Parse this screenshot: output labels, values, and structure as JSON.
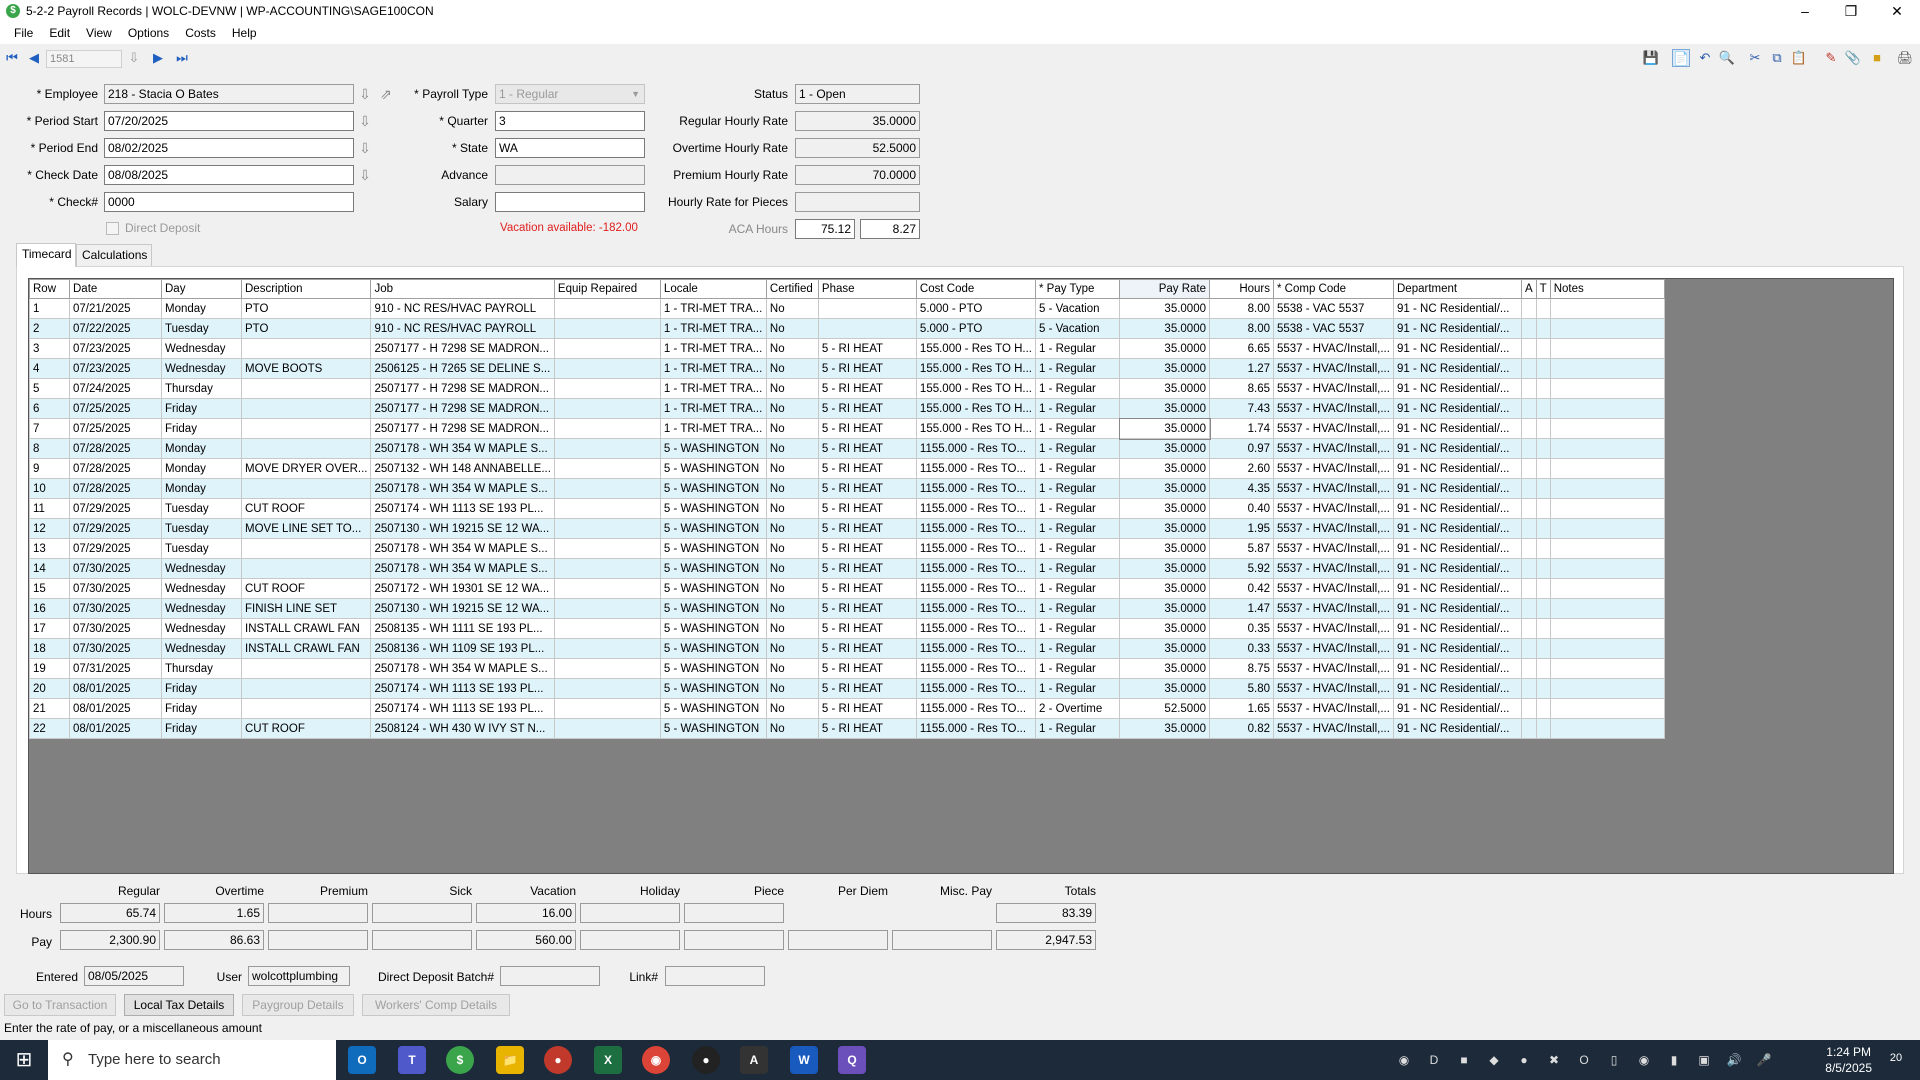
{
  "window": {
    "title": "5-2-2 Payroll Records  |  WOLC-DEVNW  |  WP-ACCOUNTING\\SAGE100CON"
  },
  "menu": [
    "File",
    "Edit",
    "View",
    "Options",
    "Costs",
    "Help"
  ],
  "nav": {
    "record": "1581"
  },
  "form": {
    "employee_label": "Employee",
    "employee": "218 - Stacia O Bates",
    "period_start_label": "Period Start",
    "period_start": "07/20/2025",
    "period_end_label": "Period End",
    "period_end": "08/02/2025",
    "check_date_label": "Check Date",
    "check_date": "08/08/2025",
    "check_no_label": "Check#",
    "check_no": "0000",
    "direct_deposit_label": "Direct Deposit",
    "payroll_type_label": "Payroll Type",
    "payroll_type": "1 - Regular",
    "quarter_label": "Quarter",
    "quarter": "3",
    "state_label": "State",
    "state": "WA",
    "advance_label": "Advance",
    "advance": "",
    "salary_label": "Salary",
    "salary": "",
    "vacation_available": "Vacation available:  -182.00",
    "status_label": "Status",
    "status": "1 - Open",
    "regular_rate_label": "Regular Hourly Rate",
    "regular_rate": "35.0000",
    "overtime_rate_label": "Overtime Hourly Rate",
    "overtime_rate": "52.5000",
    "premium_rate_label": "Premium Hourly Rate",
    "premium_rate": "70.0000",
    "pieces_rate_label": "Hourly Rate for Pieces",
    "pieces_rate": "",
    "aca_hours_label": "ACA Hours",
    "aca_hours_1": "75.12",
    "aca_hours_2": "8.27"
  },
  "tabs": [
    "Timecard",
    "Calculations"
  ],
  "grid": {
    "columns": [
      "Row",
      "Date",
      "Day",
      "Description",
      "Job",
      "Equip Repaired",
      "Locale",
      "Certified",
      "Phase",
      "Cost Code",
      "* Pay Type",
      "Pay Rate",
      "Hours",
      "* Comp Code",
      "Department",
      "A",
      "T",
      "Notes"
    ],
    "rows": [
      [
        "1",
        "07/21/2025",
        "Monday",
        "PTO",
        "910 - NC RES/HVAC PAYROLL",
        "",
        "1 - TRI-MET TRA...",
        "No",
        "",
        "5.000 - PTO",
        "5 - Vacation",
        "35.0000",
        "8.00",
        "5538 - VAC 5537",
        "91 - NC Residential/...",
        "",
        "",
        ""
      ],
      [
        "2",
        "07/22/2025",
        "Tuesday",
        "PTO",
        "910 - NC RES/HVAC PAYROLL",
        "",
        "1 - TRI-MET TRA...",
        "No",
        "",
        "5.000 - PTO",
        "5 - Vacation",
        "35.0000",
        "8.00",
        "5538 - VAC 5537",
        "91 - NC Residential/...",
        "",
        "",
        ""
      ],
      [
        "3",
        "07/23/2025",
        "Wednesday",
        "",
        "2507177 - H 7298 SE MADRON...",
        "",
        "1 - TRI-MET TRA...",
        "No",
        "5 - RI HEAT",
        "155.000 - Res TO H...",
        "1 - Regular",
        "35.0000",
        "6.65",
        "5537 - HVAC/Install,...",
        "91 - NC Residential/...",
        "",
        "",
        ""
      ],
      [
        "4",
        "07/23/2025",
        "Wednesday",
        "MOVE BOOTS",
        "2506125 - H 7265 SE DELINE S...",
        "",
        "1 - TRI-MET TRA...",
        "No",
        "5 - RI HEAT",
        "155.000 - Res TO H...",
        "1 - Regular",
        "35.0000",
        "1.27",
        "5537 - HVAC/Install,...",
        "91 - NC Residential/...",
        "",
        "",
        ""
      ],
      [
        "5",
        "07/24/2025",
        "Thursday",
        "",
        "2507177 - H 7298 SE MADRON...",
        "",
        "1 - TRI-MET TRA...",
        "No",
        "5 - RI HEAT",
        "155.000 - Res TO H...",
        "1 - Regular",
        "35.0000",
        "8.65",
        "5537 - HVAC/Install,...",
        "91 - NC Residential/...",
        "",
        "",
        ""
      ],
      [
        "6",
        "07/25/2025",
        "Friday",
        "",
        "2507177 - H 7298 SE MADRON...",
        "",
        "1 - TRI-MET TRA...",
        "No",
        "5 - RI HEAT",
        "155.000 - Res TO H...",
        "1 - Regular",
        "35.0000",
        "7.43",
        "5537 - HVAC/Install,...",
        "91 - NC Residential/...",
        "",
        "",
        ""
      ],
      [
        "7",
        "07/25/2025",
        "Friday",
        "",
        "2507177 - H 7298 SE MADRON...",
        "",
        "1 - TRI-MET TRA...",
        "No",
        "5 - RI HEAT",
        "155.000 - Res TO H...",
        "1 - Regular",
        "35.0000",
        "1.74",
        "5537 - HVAC/Install,...",
        "91 - NC Residential/...",
        "",
        "",
        ""
      ],
      [
        "8",
        "07/28/2025",
        "Monday",
        "",
        "2507178 - WH 354 W MAPLE S...",
        "",
        "5 - WASHINGTON",
        "No",
        "5 - RI HEAT",
        "1155.000 - Res TO...",
        "1 - Regular",
        "35.0000",
        "0.97",
        "5537 - HVAC/Install,...",
        "91 - NC Residential/...",
        "",
        "",
        ""
      ],
      [
        "9",
        "07/28/2025",
        "Monday",
        "MOVE DRYER OVER...",
        "2507132 - WH 148 ANNABELLE...",
        "",
        "5 - WASHINGTON",
        "No",
        "5 - RI HEAT",
        "1155.000 - Res TO...",
        "1 - Regular",
        "35.0000",
        "2.60",
        "5537 - HVAC/Install,...",
        "91 - NC Residential/...",
        "",
        "",
        ""
      ],
      [
        "10",
        "07/28/2025",
        "Monday",
        "",
        "2507178 - WH 354 W MAPLE S...",
        "",
        "5 - WASHINGTON",
        "No",
        "5 - RI HEAT",
        "1155.000 - Res TO...",
        "1 - Regular",
        "35.0000",
        "4.35",
        "5537 - HVAC/Install,...",
        "91 - NC Residential/...",
        "",
        "",
        ""
      ],
      [
        "11",
        "07/29/2025",
        "Tuesday",
        "CUT ROOF",
        "2507174 - WH 1113 SE 193 PL...",
        "",
        "5 - WASHINGTON",
        "No",
        "5 - RI HEAT",
        "1155.000 - Res TO...",
        "1 - Regular",
        "35.0000",
        "0.40",
        "5537 - HVAC/Install,...",
        "91 - NC Residential/...",
        "",
        "",
        ""
      ],
      [
        "12",
        "07/29/2025",
        "Tuesday",
        "MOVE LINE SET TO...",
        "2507130 - WH 19215 SE 12 WA...",
        "",
        "5 - WASHINGTON",
        "No",
        "5 - RI HEAT",
        "1155.000 - Res TO...",
        "1 - Regular",
        "35.0000",
        "1.95",
        "5537 - HVAC/Install,...",
        "91 - NC Residential/...",
        "",
        "",
        ""
      ],
      [
        "13",
        "07/29/2025",
        "Tuesday",
        "",
        "2507178 - WH 354 W MAPLE S...",
        "",
        "5 - WASHINGTON",
        "No",
        "5 - RI HEAT",
        "1155.000 - Res TO...",
        "1 - Regular",
        "35.0000",
        "5.87",
        "5537 - HVAC/Install,...",
        "91 - NC Residential/...",
        "",
        "",
        ""
      ],
      [
        "14",
        "07/30/2025",
        "Wednesday",
        "",
        "2507178 - WH 354 W MAPLE S...",
        "",
        "5 - WASHINGTON",
        "No",
        "5 - RI HEAT",
        "1155.000 - Res TO...",
        "1 - Regular",
        "35.0000",
        "5.92",
        "5537 - HVAC/Install,...",
        "91 - NC Residential/...",
        "",
        "",
        ""
      ],
      [
        "15",
        "07/30/2025",
        "Wednesday",
        "CUT ROOF",
        "2507172 - WH 19301 SE 12 WA...",
        "",
        "5 - WASHINGTON",
        "No",
        "5 - RI HEAT",
        "1155.000 - Res TO...",
        "1 - Regular",
        "35.0000",
        "0.42",
        "5537 - HVAC/Install,...",
        "91 - NC Residential/...",
        "",
        "",
        ""
      ],
      [
        "16",
        "07/30/2025",
        "Wednesday",
        "FINISH LINE SET",
        "2507130 - WH 19215 SE 12 WA...",
        "",
        "5 - WASHINGTON",
        "No",
        "5 - RI HEAT",
        "1155.000 - Res TO...",
        "1 - Regular",
        "35.0000",
        "1.47",
        "5537 - HVAC/Install,...",
        "91 - NC Residential/...",
        "",
        "",
        ""
      ],
      [
        "17",
        "07/30/2025",
        "Wednesday",
        "INSTALL CRAWL FAN",
        "2508135 - WH 1111 SE 193 PL...",
        "",
        "5 - WASHINGTON",
        "No",
        "5 - RI HEAT",
        "1155.000 - Res TO...",
        "1 - Regular",
        "35.0000",
        "0.35",
        "5537 - HVAC/Install,...",
        "91 - NC Residential/...",
        "",
        "",
        ""
      ],
      [
        "18",
        "07/30/2025",
        "Wednesday",
        "INSTALL CRAWL FAN",
        "2508136 - WH 1109 SE 193 PL...",
        "",
        "5 - WASHINGTON",
        "No",
        "5 - RI HEAT",
        "1155.000 - Res TO...",
        "1 - Regular",
        "35.0000",
        "0.33",
        "5537 - HVAC/Install,...",
        "91 - NC Residential/...",
        "",
        "",
        ""
      ],
      [
        "19",
        "07/31/2025",
        "Thursday",
        "",
        "2507178 - WH 354 W MAPLE S...",
        "",
        "5 - WASHINGTON",
        "No",
        "5 - RI HEAT",
        "1155.000 - Res TO...",
        "1 - Regular",
        "35.0000",
        "8.75",
        "5537 - HVAC/Install,...",
        "91 - NC Residential/...",
        "",
        "",
        ""
      ],
      [
        "20",
        "08/01/2025",
        "Friday",
        "",
        "2507174 - WH 1113 SE 193 PL...",
        "",
        "5 - WASHINGTON",
        "No",
        "5 - RI HEAT",
        "1155.000 - Res TO...",
        "1 - Regular",
        "35.0000",
        "5.80",
        "5537 - HVAC/Install,...",
        "91 - NC Residential/...",
        "",
        "",
        ""
      ],
      [
        "21",
        "08/01/2025",
        "Friday",
        "",
        "2507174 - WH 1113 SE 193 PL...",
        "",
        "5 - WASHINGTON",
        "No",
        "5 - RI HEAT",
        "1155.000 - Res TO...",
        "2 - Overtime",
        "52.5000",
        "1.65",
        "5537 - HVAC/Install,...",
        "91 - NC Residential/...",
        "",
        "",
        ""
      ],
      [
        "22",
        "08/01/2025",
        "Friday",
        "CUT ROOF",
        "2508124 - WH 430 W IVY ST N...",
        "",
        "5 - WASHINGTON",
        "No",
        "5 - RI HEAT",
        "1155.000 - Res TO...",
        "1 - Regular",
        "35.0000",
        "0.82",
        "5537 - HVAC/Install,...",
        "91 - NC Residential/...",
        "",
        "",
        ""
      ]
    ]
  },
  "totals": {
    "headers": [
      "Regular",
      "Overtime",
      "Premium",
      "Sick",
      "Vacation",
      "Holiday",
      "Piece",
      "Per Diem",
      "Misc. Pay",
      "Totals"
    ],
    "hours_label": "Hours",
    "pay_label": "Pay",
    "hours": [
      "65.74",
      "1.65",
      "",
      "",
      "16.00",
      "",
      "",
      "83.39"
    ],
    "pay": [
      "2,300.90",
      "86.63",
      "",
      "",
      "560.00",
      "",
      "",
      "",
      "",
      "2,947.53"
    ]
  },
  "footer": {
    "entered_label": "Entered",
    "entered": "08/05/2025",
    "user_label": "User",
    "user": "wolcottplumbing",
    "batch_label": "Direct Deposit Batch#",
    "batch": "",
    "link_label": "Link#",
    "link": ""
  },
  "buttons": [
    "Go to Transaction",
    "Local Tax Details",
    "Paygroup Details",
    "Workers' Comp Details"
  ],
  "status_text": "Enter the rate of pay, or a miscellaneous amount",
  "taskbar": {
    "search_placeholder": "Type here to search",
    "time": "1:24 PM",
    "date": "8/5/2025",
    "notifications": "20"
  }
}
